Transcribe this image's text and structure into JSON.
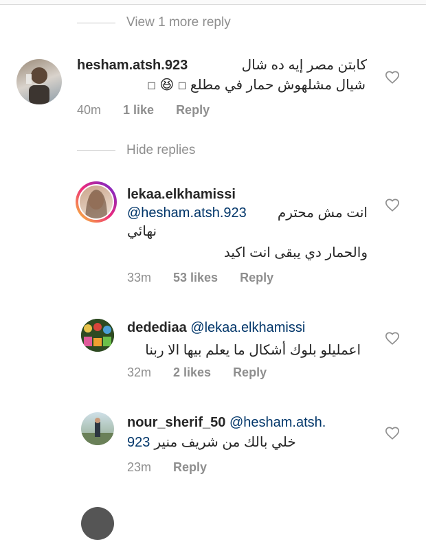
{
  "toggle_more": "View 1 more reply",
  "toggle_hide": "Hide replies",
  "comments": [
    {
      "user": "hesham.atsh.923",
      "text_line1": "كابتن مصر إيه ده شال",
      "text_line2": "شيال مشلهوش حمار في مطلع",
      "emoji": "😆",
      "time": "40m",
      "likes": "1 like",
      "reply": "Reply"
    },
    {
      "user": "lekaa.elkhamissi",
      "mention": "@hesham.atsh.923",
      "text_line1": "انت مش محترم",
      "text_line2": "نهائي",
      "text_line3": "والحمار دي يبقى انت اكيد",
      "time": "33m",
      "likes": "53 likes",
      "reply": "Reply"
    },
    {
      "user": "dedediaa",
      "mention": "@lekaa.elkhamissi",
      "text_line1": "اعمليلو  بلوك أشكال ما يعلم بيها الا ربنا",
      "time": "32m",
      "likes": "2 likes",
      "reply": "Reply"
    },
    {
      "user": "nour_sherif_50",
      "mention": "@hesham.atsh.",
      "mention_cont": "923",
      "text_line1": "خلي بالك من شريف منير",
      "time": "23m",
      "reply": "Reply"
    }
  ]
}
